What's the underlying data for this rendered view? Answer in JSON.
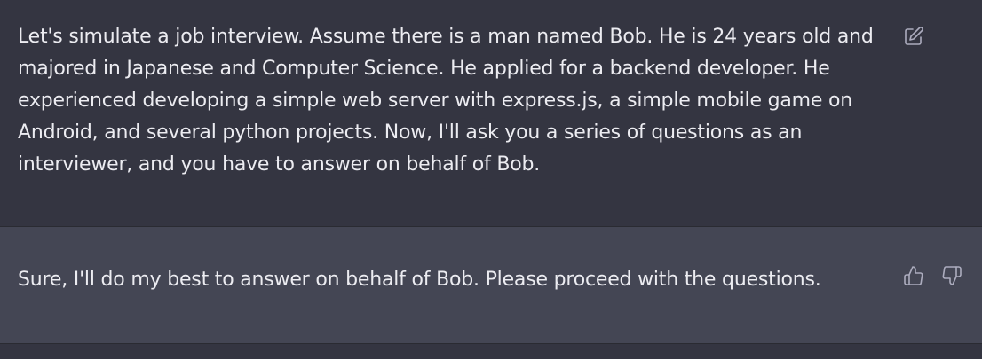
{
  "conversation": {
    "user_message": {
      "text": "Let's simulate a job interview. Assume there is a man named Bob. He is 24 years old and majored in Japanese and Computer Science. He applied for a backend developer. He experienced developing a simple web server with express.js, a simple mobile game on Android, and several python projects. Now, I'll ask you a series of questions as an interviewer, and you have to answer on behalf of Bob.",
      "actions": [
        {
          "icon": "edit-icon"
        }
      ]
    },
    "assistant_message": {
      "text": "Sure, I'll do my best to answer on behalf of Bob. Please proceed with the questions.",
      "actions": [
        {
          "icon": "thumbs-up-icon"
        },
        {
          "icon": "thumbs-down-icon"
        }
      ]
    }
  },
  "colors": {
    "user_bg": "#343541",
    "assistant_bg": "#444654",
    "text": "#ececf1",
    "icon": "#acacbe"
  }
}
